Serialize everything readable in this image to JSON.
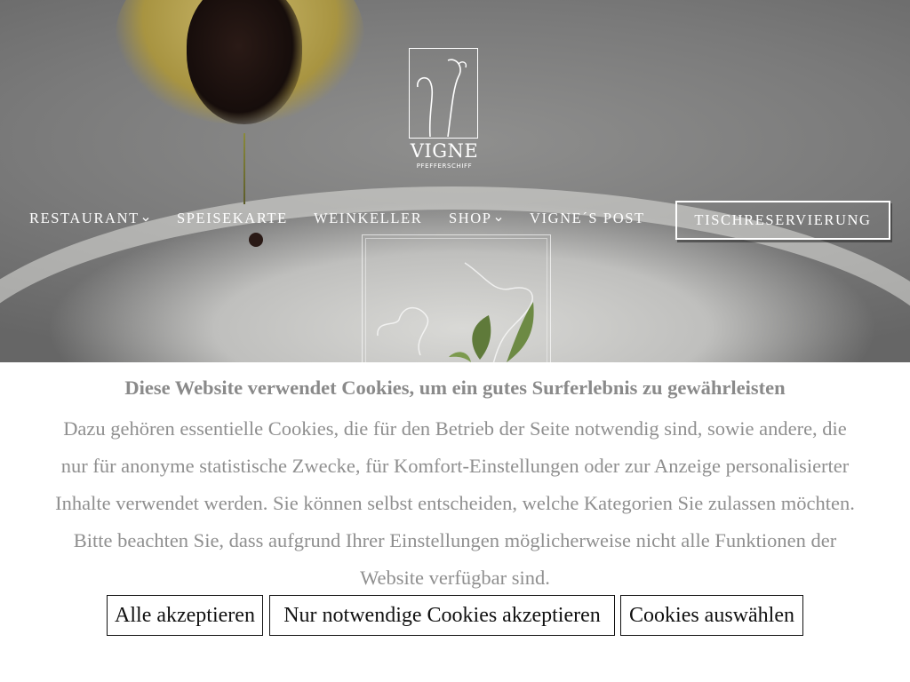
{
  "logo": {
    "word": "VIGNE",
    "sub": "PFEFFERSCHIFF"
  },
  "nav": {
    "items": [
      {
        "label": "RESTAURANT",
        "has_dropdown": true
      },
      {
        "label": "SPEISEKARTE",
        "has_dropdown": false
      },
      {
        "label": "WEINKELLER",
        "has_dropdown": false
      },
      {
        "label": "SHOP",
        "has_dropdown": true
      },
      {
        "label": "VIGNE´S POST",
        "has_dropdown": false
      }
    ],
    "reserve_label": "TISCHRESERVIERUNG"
  },
  "cookie_banner": {
    "title": "Diese Website verwendet Cookies, um ein gutes Surferlebnis zu gewährleisten",
    "text_lines": [
      "Dazu gehören essentielle Cookies, die für den Betrieb der Seite notwendig sind, sowie andere, die",
      "nur für anonyme statistische Zwecke, für Komfort-Einstellungen oder zur Anzeige personalisierter",
      "Inhalte verwendet werden. Sie können selbst entscheiden, welche Kategorien Sie zulassen möchten.",
      "Bitte beachten Sie, dass aufgrund Ihrer Einstellungen möglicherweise nicht alle Funktionen der",
      "Website verfügbar sind."
    ],
    "buttons": {
      "accept_all": "Alle akzeptieren",
      "accept_necessary": "Nur notwendige Cookies akzeptieren",
      "select": "Cookies auswählen"
    }
  },
  "colors": {
    "hero_overlay": "#7a7a7a",
    "banner_text": "#8f8f8f",
    "button_border": "#111111"
  }
}
